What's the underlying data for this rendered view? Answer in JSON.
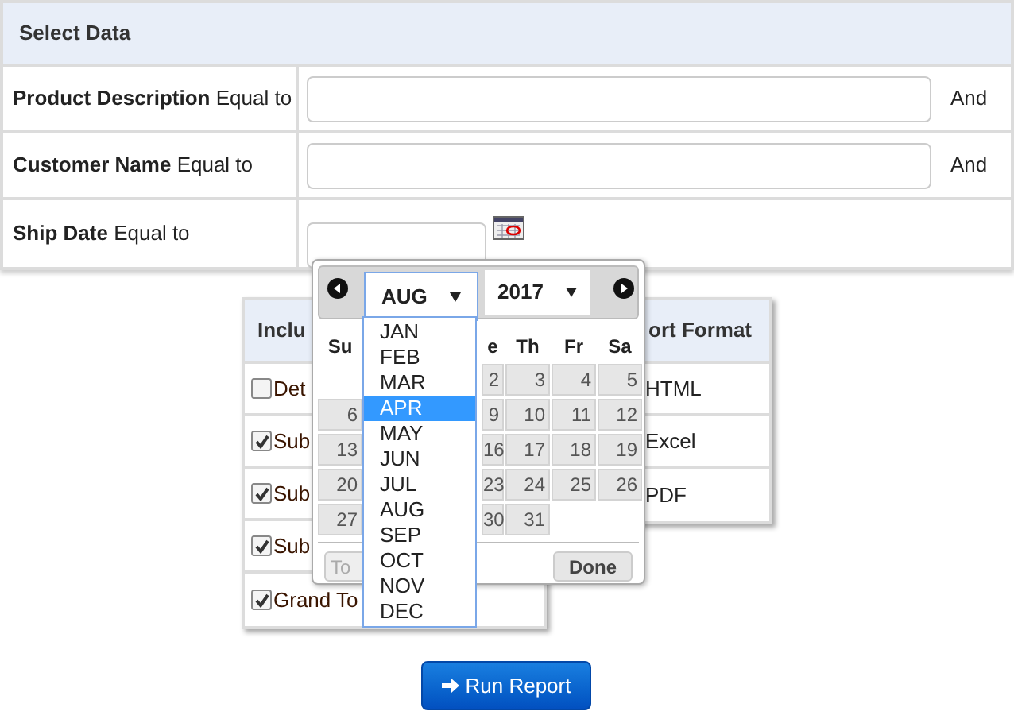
{
  "select_data": {
    "title": "Select Data",
    "rows": [
      {
        "label_bold": "Product Description",
        "label_rest": "Equal to",
        "connector": "And",
        "kind": "text"
      },
      {
        "label_bold": "Customer Name",
        "label_rest": "Equal to",
        "connector": "And",
        "kind": "text"
      },
      {
        "label_bold": "Ship Date",
        "label_rest": "Equal to",
        "kind": "date"
      }
    ]
  },
  "include_panel": {
    "title": "Inclu",
    "items": [
      {
        "label": "Det",
        "checked": false
      },
      {
        "label": "Sub",
        "checked": true
      },
      {
        "label": "Sub",
        "checked": true
      },
      {
        "label": "Sub",
        "checked": true
      },
      {
        "label": "Grand To",
        "checked": true
      }
    ]
  },
  "format_panel": {
    "title": "ort Format",
    "options": [
      "HTML",
      "Excel",
      "PDF"
    ]
  },
  "datepicker": {
    "month": "AUG",
    "year": "2017",
    "weekdays": [
      "Su",
      "e",
      "Th",
      "Fr",
      "Sa"
    ],
    "weeks": [
      {
        "we": "2",
        "th": "3",
        "fr": "4",
        "sa": "5"
      },
      {
        "su": "6",
        "we": "9",
        "th": "10",
        "fr": "11",
        "sa": "12"
      },
      {
        "su": "13",
        "we": "16",
        "th": "17",
        "fr": "18",
        "sa": "19"
      },
      {
        "su": "20",
        "we": "23",
        "th": "24",
        "fr": "25",
        "sa": "26"
      },
      {
        "su": "27",
        "we": "30",
        "th": "31"
      }
    ],
    "today_button": "To",
    "done_button": "Done",
    "month_list": [
      {
        "label": "JAN",
        "selected": false
      },
      {
        "label": "FEB",
        "selected": false
      },
      {
        "label": "MAR",
        "selected": false
      },
      {
        "label": "APR",
        "selected": true
      },
      {
        "label": "MAY",
        "selected": false
      },
      {
        "label": "JUN",
        "selected": false
      },
      {
        "label": "JUL",
        "selected": false
      },
      {
        "label": "AUG",
        "selected": false
      },
      {
        "label": "SEP",
        "selected": false
      },
      {
        "label": "OCT",
        "selected": false
      },
      {
        "label": "NOV",
        "selected": false
      },
      {
        "label": "DEC",
        "selected": false
      }
    ]
  },
  "run_button": "Run Report"
}
